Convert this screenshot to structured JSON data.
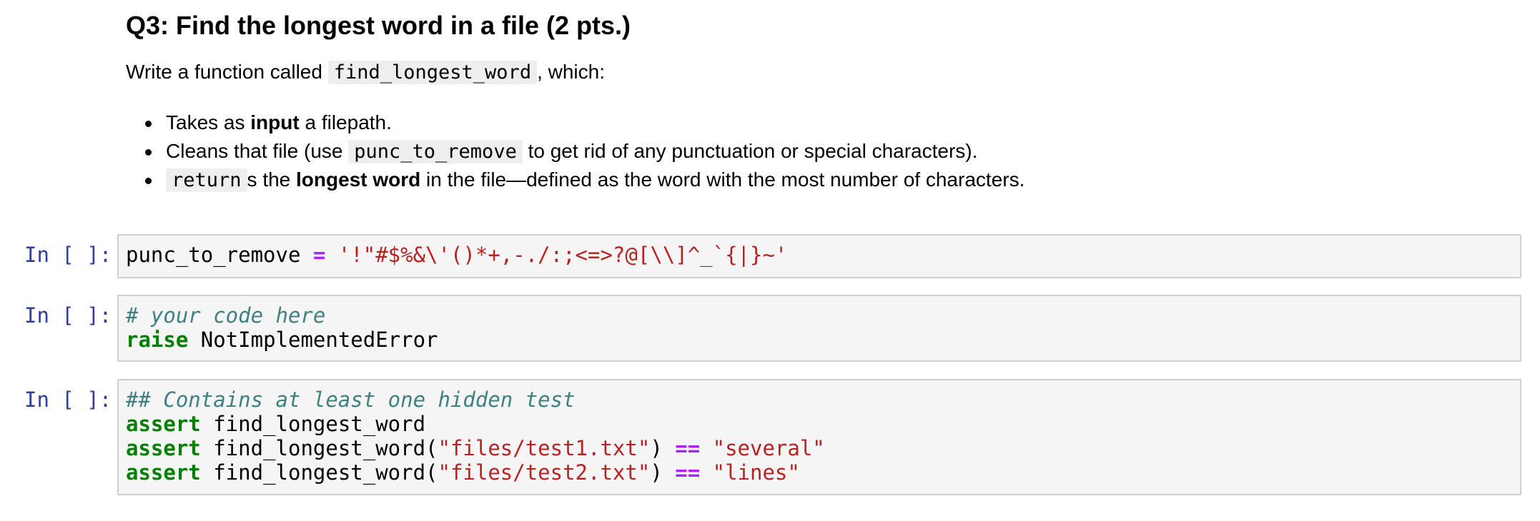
{
  "markdown": {
    "title": "Q3: Find the longest word in a file (2 pts.)",
    "intro_before": "Write a function called ",
    "intro_code": "find_longest_word",
    "intro_after": ", which:",
    "bullets": [
      {
        "before": "Takes as ",
        "bold": "input",
        "after": " a filepath."
      },
      {
        "before": "Cleans that file (use ",
        "code": "punc_to_remove",
        "after": " to get rid of any punctuation or special characters)."
      },
      {
        "code": "return",
        "mid": "s the ",
        "bold": "longest word",
        "after": " in the file—defined as the word with the most number of characters."
      }
    ]
  },
  "cells": [
    {
      "prompt": "In [ ]:",
      "lines": [
        {
          "var": "punc_to_remove",
          "eq": " = ",
          "str": "'!\"#$%&\\'()*+,-./:;<=>?@[\\\\]^_`{|}~'"
        }
      ]
    },
    {
      "prompt": "In [ ]:",
      "comment": "# your code here",
      "keyword": "raise",
      "rest": " NotImplementedError"
    },
    {
      "prompt": "In [ ]:",
      "comment": "## Contains at least one hidden test",
      "assert_kw": "assert",
      "line1_rest": " find_longest_word",
      "line2_call": " find_longest_word(",
      "line2_str": "\"files/test1.txt\"",
      "line2_close": ") ",
      "line2_op": "==",
      "line2_expected": " \"several\"",
      "line3_call": " find_longest_word(",
      "line3_str": "\"files/test2.txt\"",
      "line3_close": ") ",
      "line3_op": "==",
      "line3_expected": " \"lines\""
    }
  ]
}
